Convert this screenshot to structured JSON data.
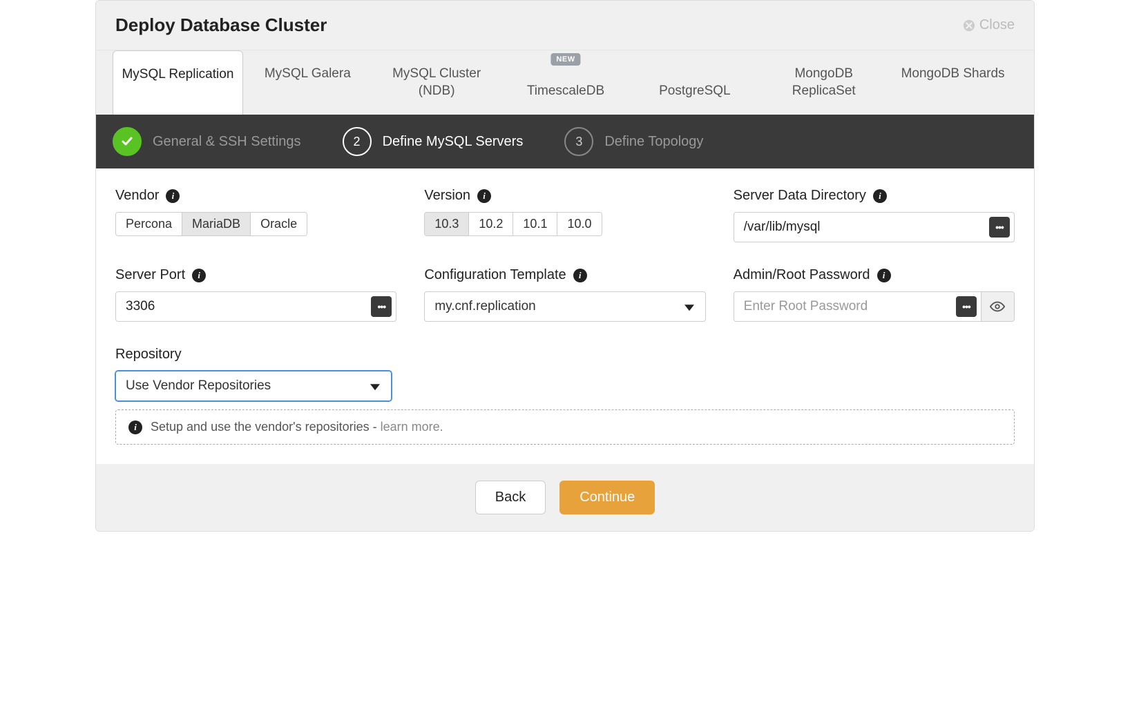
{
  "header": {
    "title": "Deploy Database Cluster",
    "close_label": "Close"
  },
  "vendor_tabs": [
    {
      "line1": "MySQL Replication",
      "badge": ""
    },
    {
      "line1": "MySQL Galera",
      "badge": ""
    },
    {
      "line1": "MySQL Cluster (NDB)",
      "badge": ""
    },
    {
      "line1": "TimescaleDB",
      "badge": "NEW"
    },
    {
      "line1": "PostgreSQL",
      "badge": ""
    },
    {
      "line1": "MongoDB ReplicaSet",
      "badge": ""
    },
    {
      "line1": "MongoDB Shards",
      "badge": ""
    }
  ],
  "wizard": {
    "step1_label": "General & SSH Settings",
    "step2_num": "2",
    "step2_label": "Define MySQL Servers",
    "step3_num": "3",
    "step3_label": "Define Topology"
  },
  "form": {
    "vendor": {
      "label": "Vendor",
      "options": [
        "Percona",
        "MariaDB",
        "Oracle"
      ],
      "selected_index": 1
    },
    "version": {
      "label": "Version",
      "options": [
        "10.3",
        "10.2",
        "10.1",
        "10.0"
      ],
      "selected_index": 0
    },
    "data_dir": {
      "label": "Server Data Directory",
      "value": "/var/lib/mysql"
    },
    "server_port": {
      "label": "Server Port",
      "value": "3306"
    },
    "config_template": {
      "label": "Configuration Template",
      "value": "my.cnf.replication"
    },
    "root_password": {
      "label": "Admin/Root Password",
      "placeholder": "Enter Root Password",
      "value": ""
    },
    "repository": {
      "label": "Repository",
      "value": "Use Vendor Repositories",
      "help_text": "Setup and use the vendor's repositories - ",
      "help_link": "learn more."
    }
  },
  "footer": {
    "back_label": "Back",
    "continue_label": "Continue"
  }
}
